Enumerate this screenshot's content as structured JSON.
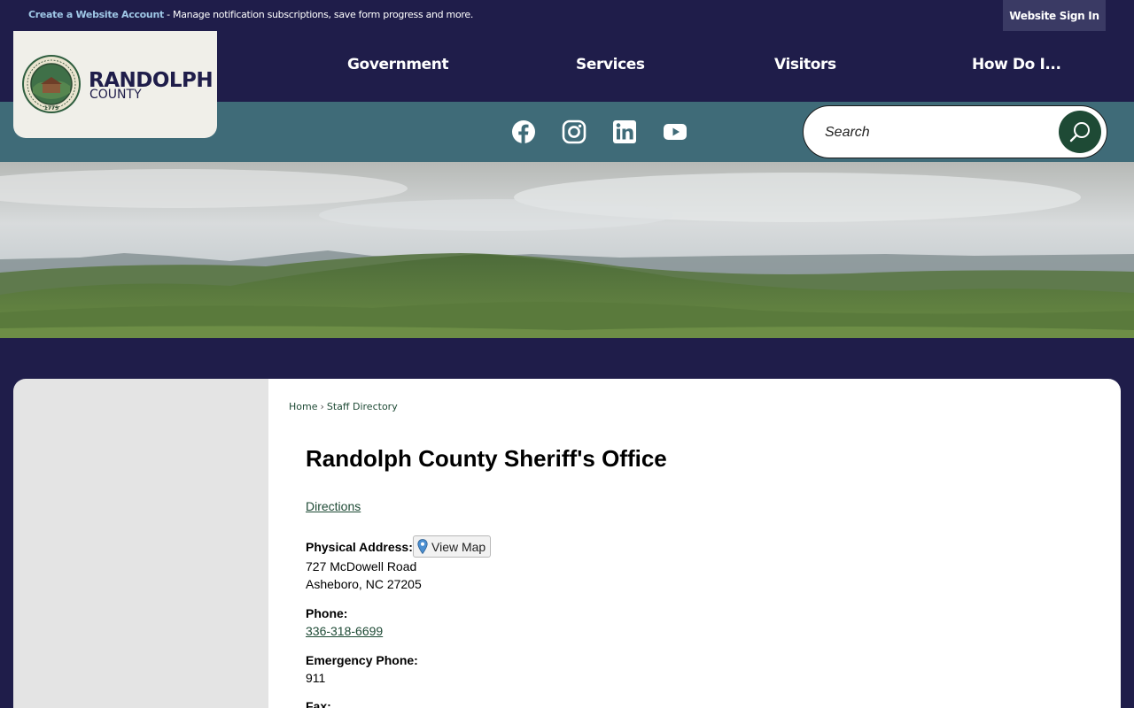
{
  "topbar": {
    "create_account_link": "Create a Website Account",
    "create_account_desc": " - Manage notification subscriptions, save form progress and more.",
    "sign_in": "Website Sign In"
  },
  "logo": {
    "name": "RANDOLPH",
    "sub": "COUNTY",
    "seal_text": "RANDOLPH COUNTY, NORTH CAROLINA",
    "seal_year": "1779"
  },
  "nav": {
    "items": [
      "Government",
      "Services",
      "Visitors",
      "How Do I..."
    ]
  },
  "social": {
    "items": [
      "facebook-icon",
      "instagram-icon",
      "linkedin-icon",
      "youtube-icon"
    ]
  },
  "search": {
    "placeholder": "Search"
  },
  "breadcrumb": {
    "home": "Home",
    "separator": "›",
    "current": "Staff Directory"
  },
  "page": {
    "title": "Randolph County Sheriff's Office",
    "directions": "Directions",
    "physical_address_label": "Physical Address:",
    "view_map": "View Map",
    "address_line1": "727 McDowell Road",
    "address_line2": "Asheboro, NC 27205",
    "phone_label": "Phone:",
    "phone": "336-318-6699",
    "emergency_label": "Emergency Phone:",
    "emergency": "911",
    "fax_label": "Fax:"
  },
  "colors": {
    "navy": "#1f1d4a",
    "teal": "#3f6b78",
    "green": "#1e4a35"
  }
}
